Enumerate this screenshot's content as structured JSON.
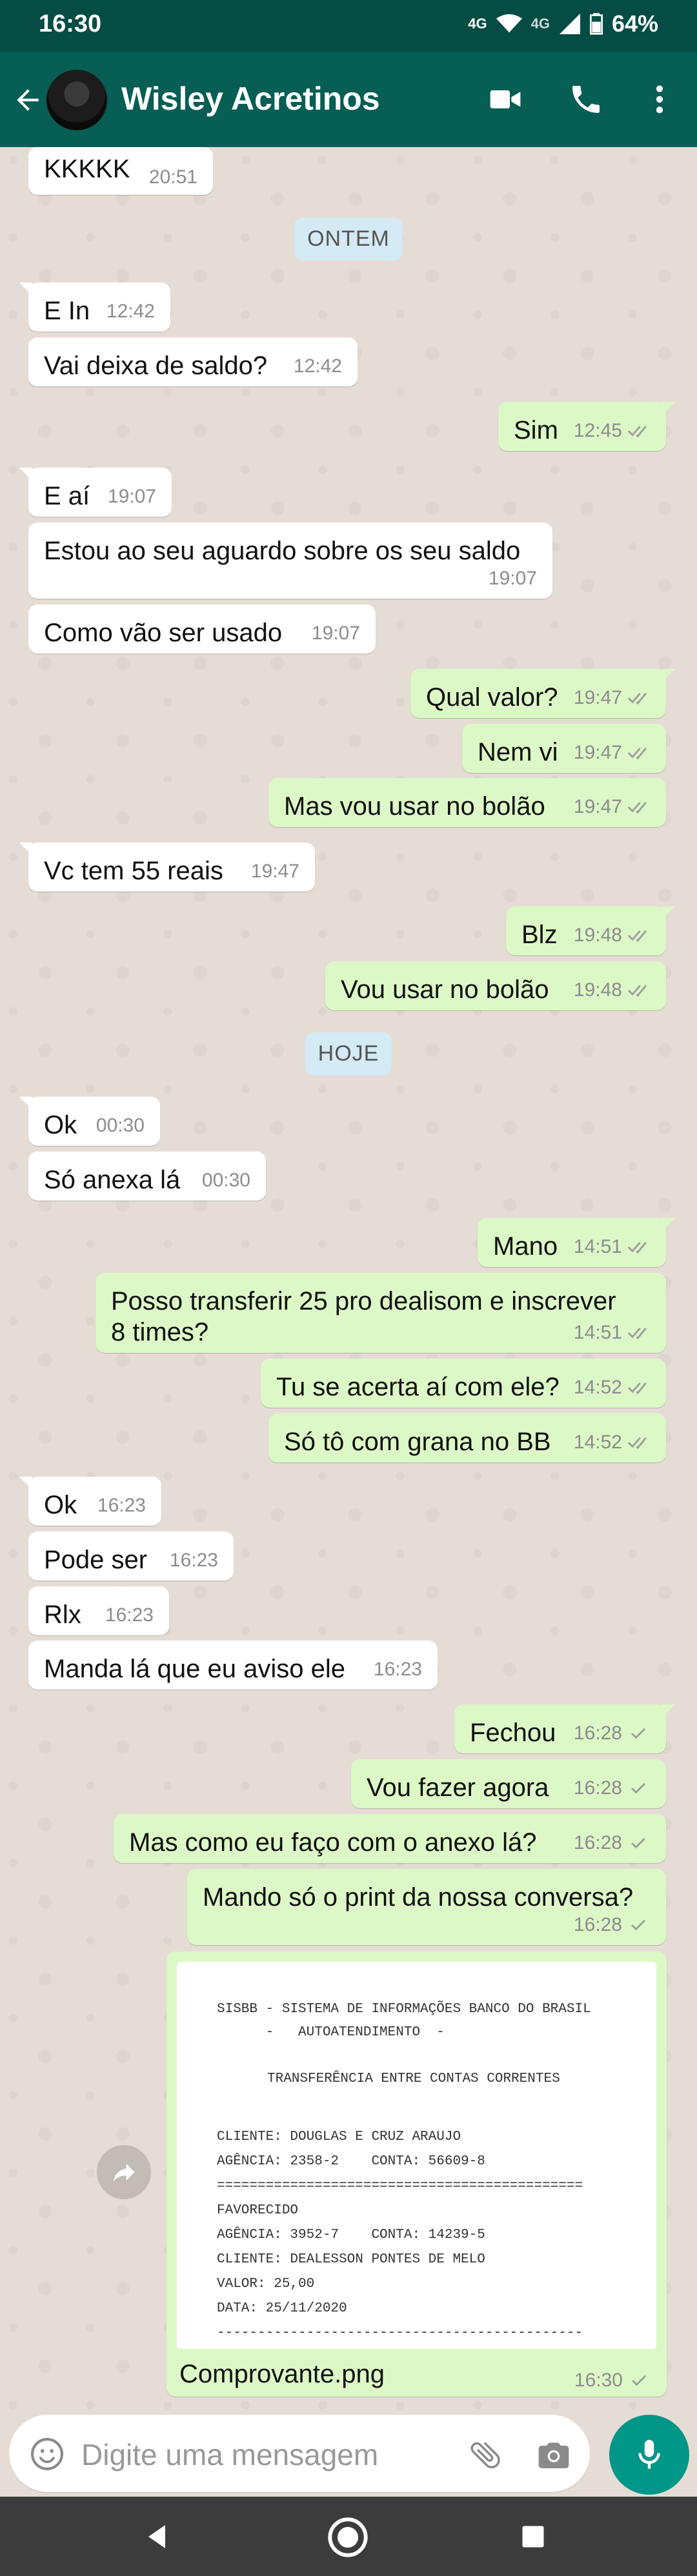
{
  "status_bar": {
    "time": "16:30",
    "network_1": "4G",
    "network_2": "4G",
    "battery": "64%"
  },
  "header": {
    "contact_name": "Wisley Acretinos"
  },
  "day_separators": {
    "yesterday": "ONTEM",
    "today": "HOJE"
  },
  "messages": [
    {
      "text": "KKKKK",
      "time": "20:51"
    },
    {
      "text": "E In",
      "time": "12:42"
    },
    {
      "text": "Vai deixa de saldo?",
      "time": "12:42"
    },
    {
      "text": "Sim",
      "time": "12:45"
    },
    {
      "text": "E aí",
      "time": "19:07"
    },
    {
      "text": "Estou ao seu aguardo sobre os seu saldo",
      "time": "19:07"
    },
    {
      "text": "Como vão ser usado",
      "time": "19:07"
    },
    {
      "text": "Qual valor?",
      "time": "19:47"
    },
    {
      "text": "Nem vi",
      "time": "19:47"
    },
    {
      "text": "Mas vou usar no bolão",
      "time": "19:47"
    },
    {
      "text": "Vc tem 55 reais",
      "time": "19:47"
    },
    {
      "text": "Blz",
      "time": "19:48"
    },
    {
      "text": "Vou usar no bolão",
      "time": "19:48"
    },
    {
      "text": "Ok",
      "time": "00:30"
    },
    {
      "text": "Só anexa lá",
      "time": "00:30"
    },
    {
      "text": "Mano",
      "time": "14:51"
    },
    {
      "text": "Posso transferir 25 pro dealisom e inscrever 8 times?",
      "time": "14:51"
    },
    {
      "text": "Tu se acerta aí com ele?",
      "time": "14:52"
    },
    {
      "text": "Só tô com grana no BB",
      "time": "14:52"
    },
    {
      "text": "Ok",
      "time": "16:23"
    },
    {
      "text": "Pode ser",
      "time": "16:23"
    },
    {
      "text": "Rlx",
      "time": "16:23"
    },
    {
      "text": "Manda lá que eu aviso ele",
      "time": "16:23"
    },
    {
      "text": "Fechou",
      "time": "16:28"
    },
    {
      "text": "Vou fazer agora",
      "time": "16:28"
    },
    {
      "text": "Mas como eu faço com o anexo lá?",
      "time": "16:28"
    },
    {
      "text": "Mando só o print da nossa conversa?",
      "time": "16:28"
    }
  ],
  "attachment": {
    "lines": [
      "SISBB - SISTEMA DE INFORMAÇÕES BANCO DO BRASIL",
      "      -   AUTOATENDIMENTO  -",
      "TRANSFERÊNCIA ENTRE CONTAS CORRENTES",
      "CLIENTE: DOUGLAS E CRUZ ARAUJO",
      "AGÊNCIA: 2358-2    CONTA: 56609-8",
      "=============================================",
      "FAVORECIDO",
      "AGÊNCIA: 3952-7    CONTA: 14239-5",
      "CLIENTE: DEALESSON PONTES DE MELO",
      "VALOR: 25,00",
      "DATA: 25/11/2020",
      "---------------------------------------------"
    ],
    "filename": "Comprovante.png",
    "time": "16:30"
  },
  "input": {
    "placeholder": "Digite uma mensagem"
  }
}
